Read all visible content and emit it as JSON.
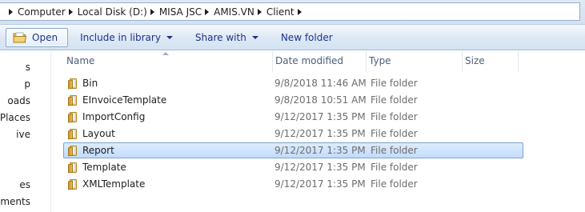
{
  "address_bar": {
    "crumbs": [
      "Computer",
      "Local Disk (D:)",
      "MISA JSC",
      "AMIS.VN",
      "Client"
    ]
  },
  "toolbar": {
    "open_label": "Open",
    "include_label": "Include in library",
    "share_label": "Share with",
    "new_folder_label": "New folder"
  },
  "nav_pane": {
    "items": [
      "s",
      "p",
      "oads",
      "t Places",
      "ive",
      "es",
      "uments"
    ]
  },
  "columns": {
    "name": "Name",
    "date_modified": "Date modified",
    "type": "Type",
    "size": "Size"
  },
  "files": [
    {
      "name": "Bin",
      "date": "9/8/2018 11:46 AM",
      "type": "File folder",
      "selected": false
    },
    {
      "name": "EInvoiceTemplate",
      "date": "9/8/2018 10:51 AM",
      "type": "File folder",
      "selected": false
    },
    {
      "name": "ImportConfig",
      "date": "9/12/2017 1:35 PM",
      "type": "File folder",
      "selected": false
    },
    {
      "name": "Layout",
      "date": "9/12/2017 1:35 PM",
      "type": "File folder",
      "selected": false
    },
    {
      "name": "Report",
      "date": "9/12/2017 1:35 PM",
      "type": "File folder",
      "selected": true
    },
    {
      "name": "Template",
      "date": "9/12/2017 1:35 PM",
      "type": "File folder",
      "selected": false
    },
    {
      "name": "XMLTemplate",
      "date": "9/12/2017 1:35 PM",
      "type": "File folder",
      "selected": false
    }
  ],
  "colors": {
    "toolbar_text": "#1e3287",
    "header_text": "#4c607a",
    "selection_fill": "#c2dcfd",
    "selection_border": "#7da2ce"
  },
  "icons": {
    "folder": "folder-icon",
    "open": "open-folder-icon",
    "dropdown": "chevron-down-icon",
    "crumb_separator": "chevron-right-icon"
  }
}
